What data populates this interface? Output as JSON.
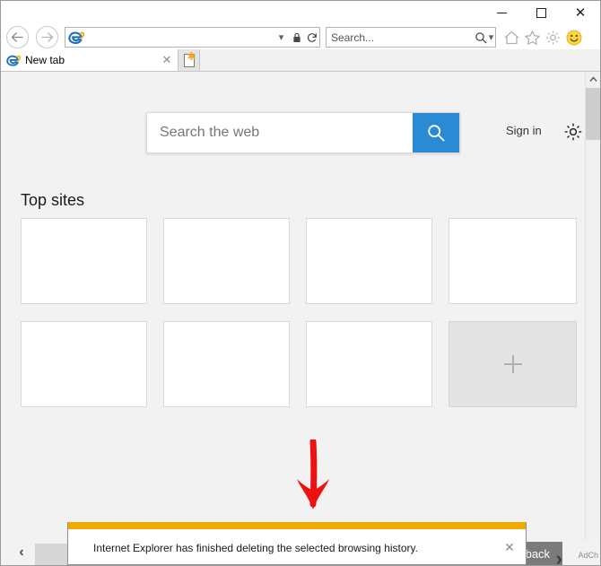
{
  "window": {
    "controls": {
      "minimize_label": "–",
      "maximize_label": "",
      "close_label": "✕"
    }
  },
  "navbar": {
    "back_glyph": "←",
    "forward_glyph": "→",
    "url_value": "",
    "url_placeholder": "",
    "dropdown_glyph": "▾",
    "lock_glyph": "🔒",
    "refresh_glyph": "↻",
    "search_value": "",
    "search_placeholder": "Search...",
    "search_dropdown_glyph": "▾",
    "icons": {
      "home": "home-icon",
      "favorites": "star-icon",
      "tools": "gear-icon",
      "feedback": "smiley-icon"
    }
  },
  "tabs": {
    "active": {
      "title": "New tab",
      "close_label": "✕"
    },
    "new_tab_button_label": "New tab"
  },
  "newtabpage": {
    "search": {
      "value": "",
      "placeholder": "Search the web",
      "button_label": "search-icon",
      "accent_color": "#2a8ad4"
    },
    "sign_in_label": "Sign in",
    "settings_icon": "gear-icon",
    "topsites_heading": "Top sites",
    "tiles": [
      {
        "label": "",
        "type": "site"
      },
      {
        "label": "",
        "type": "site"
      },
      {
        "label": "",
        "type": "site"
      },
      {
        "label": "",
        "type": "site"
      },
      {
        "label": "",
        "type": "site"
      },
      {
        "label": "",
        "type": "site"
      },
      {
        "label": "",
        "type": "site"
      },
      {
        "label": "+",
        "type": "add"
      }
    ]
  },
  "annotation": {
    "arrow_color": "#ee1111",
    "direction": "down"
  },
  "scrollbar": {
    "up_glyph": "⌃",
    "down_glyph": "⌄"
  },
  "bottom": {
    "prev_chevron": "‹",
    "feedback_label": "Feedback",
    "feedback_chevron": "›",
    "adchoices_label": "AdCh"
  },
  "notification": {
    "message": "Internet Explorer has finished deleting the selected browsing history.",
    "close_label": "✕",
    "accent_color": "#f0ab00"
  }
}
